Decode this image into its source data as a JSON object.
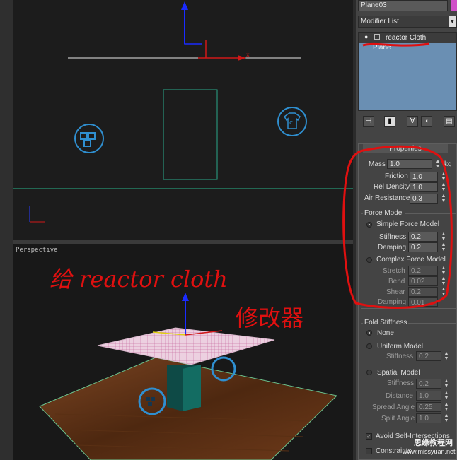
{
  "front_view": {
    "axis_x_label": "x",
    "label_c": "c"
  },
  "perspective_view": {
    "label": "Perspective",
    "annotation_line1": "给 reactor cloth",
    "annotation_line2": "修改器"
  },
  "panel": {
    "object_name": "Plane03",
    "modifier_list_label": "Modifier List",
    "stack_items": [
      "reactor Cloth",
      "Plane"
    ],
    "properties_title": "Properties",
    "mass_label": "Mass",
    "mass_value": "1.0",
    "mass_unit": "kg",
    "friction_label": "Friction",
    "friction_value": "1.0",
    "rel_density_label": "Rel Density",
    "rel_density_value": "1.0",
    "air_resistance_label": "Air Resistance",
    "air_resistance_value": "0.3",
    "force_model_title": "Force Model",
    "simple_force_label": "Simple Force Model",
    "simple_stiffness_label": "Stiffness",
    "simple_stiffness_value": "0.2",
    "simple_damping_label": "Damping",
    "simple_damping_value": "0.2",
    "complex_force_label": "Complex Force Model",
    "stretch_label": "Stretch",
    "stretch_value": "0.2",
    "bend_label": "Bend",
    "bend_value": "0.02",
    "shear_label": "Shear",
    "shear_value": "0.2",
    "complex_damping_label": "Damping",
    "complex_damping_value": "0.01",
    "fold_title": "Fold Stiffness",
    "none_label": "None",
    "uniform_label": "Uniform Model",
    "uniform_stiffness_label": "Stiffness",
    "uniform_stiffness_value": "0.2",
    "spatial_label": "Spatial Model",
    "spatial_stiffness_label": "Stiffness",
    "spatial_stiffness_value": "0.2",
    "distance_label": "Distance",
    "distance_value": "1.0",
    "spread_label": "Spread Angle",
    "spread_value": "0.25",
    "split_label": "Split Angle",
    "split_value": "1.0",
    "avoid_label": "Avoid Self-Intersections",
    "constraint_label": "Constraints",
    "watermark_cn": "思缘教程网",
    "watermark_url": "www.missyuan.net"
  },
  "colors": {
    "annotation_red": "#e01010",
    "helper_blue": "#2f8fd0",
    "cloth_pink": "#e8c8d8",
    "floor_brown": "#6b3a1e"
  }
}
